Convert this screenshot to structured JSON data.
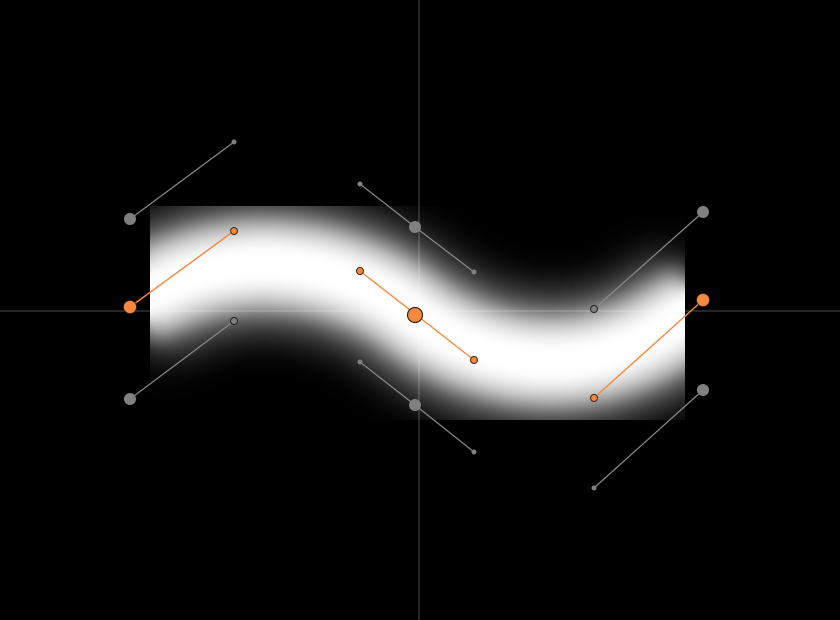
{
  "canvas": {
    "background": "#000000"
  },
  "colors": {
    "axis": "#4a4a4a",
    "stroke_white": "#ffffff",
    "selected_point": "#f5893f",
    "unselected_point": "#808080",
    "selected_handle_line": "#f5893f",
    "unselected_handle_line": "#8a8a8a",
    "point_outline": "#3a2414"
  },
  "stroke": {
    "type": "feathered-curve",
    "selected": true
  },
  "control_points": [
    {
      "id": "left",
      "state": "selected"
    },
    {
      "id": "middle",
      "state": "selected"
    },
    {
      "id": "right",
      "state": "selected"
    }
  ],
  "icons": {
    "crosshair": "crosshair-axes-icon"
  }
}
